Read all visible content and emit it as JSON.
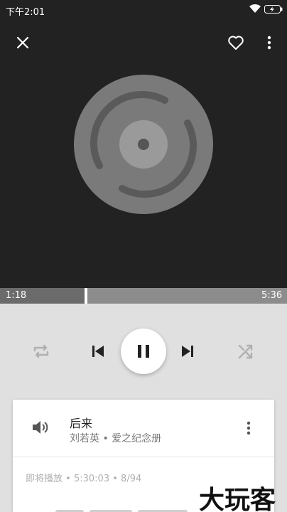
{
  "status_bar": {
    "time": "下午2:01"
  },
  "player": {
    "current_time": "1:18",
    "duration": "5:36",
    "progress_fraction": 0.232
  },
  "queue": {
    "now_playing": {
      "title": "后来",
      "artist": "刘若英",
      "separator": "•",
      "album": "爱之纪念册"
    },
    "up_next": {
      "label": "即将播放",
      "total_time": "5:30:03",
      "count": "8/94"
    }
  },
  "watermark": "大玩客",
  "colors": {
    "top_bg": "#222222",
    "controls_bg": "#e0e0e0",
    "seek_bg": "#8c8c8c"
  }
}
